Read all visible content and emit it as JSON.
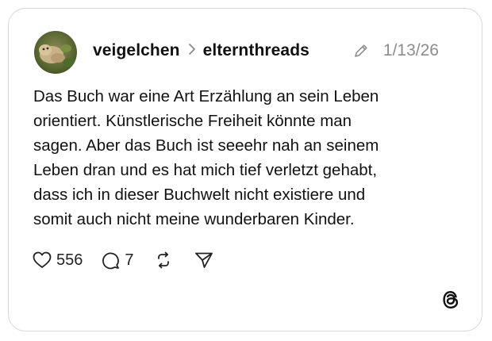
{
  "post": {
    "username": "veigelchen",
    "community": "elternthreads",
    "date": "1/13/26",
    "text": "Das Buch war eine Art Erzählung an sein Leben\norientiert. Künstlerische Freiheit könnte man\nsagen. Aber das Buch ist seeehr nah an seinem\nLeben dran und es hat mich tief verletzt gehabt,\ndass ich in dieser Buchwelt nicht existiere und\nsomit auch nicht meine wunderbaren Kinder."
  },
  "actions": {
    "likes": "556",
    "replies": "7"
  },
  "icons": {
    "edited": "pencil-icon",
    "like": "heart-icon",
    "reply": "comment-icon",
    "repost": "repost-icon",
    "share": "send-icon",
    "brand": "threads-logo-icon",
    "header_separator": "chevron-right-icon"
  }
}
